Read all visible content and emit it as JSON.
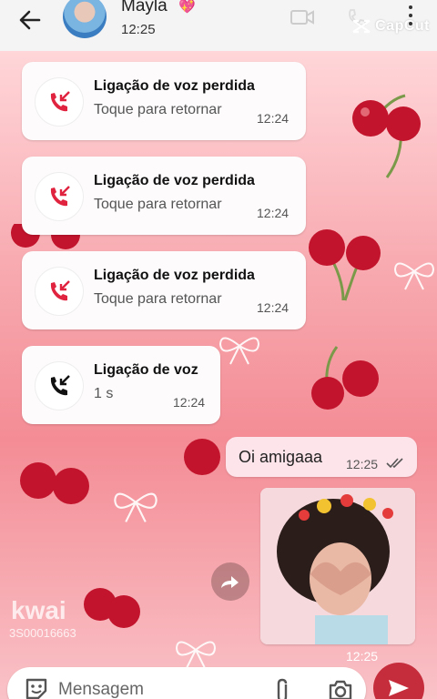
{
  "header": {
    "contact_name": "Mayla",
    "heart": "💖",
    "status": "12:25",
    "capcut_label": "CapCut"
  },
  "calls": [
    {
      "title": "Ligação de voz perdida",
      "subtitle": "Toque para retornar",
      "time": "12:24",
      "missed": true
    },
    {
      "title": "Ligação de voz perdida",
      "subtitle": "Toque para retornar",
      "time": "12:24",
      "missed": true
    },
    {
      "title": "Ligação de voz perdida",
      "subtitle": "Toque para retornar",
      "time": "12:24",
      "missed": true
    },
    {
      "title": "Ligação de voz",
      "subtitle": "1 s",
      "time": "12:24",
      "missed": false
    }
  ],
  "outgoing": {
    "text": "Oi amigaaa",
    "time": "12:25",
    "image_time": "12:25"
  },
  "watermark": {
    "brand": "kwai",
    "id": "3S00016663"
  },
  "composer": {
    "placeholder": "Mensagem"
  },
  "colors": {
    "missed_red": "#e0233f",
    "send_button": "#c62d3c",
    "bubble_out": "#fde4ea"
  }
}
